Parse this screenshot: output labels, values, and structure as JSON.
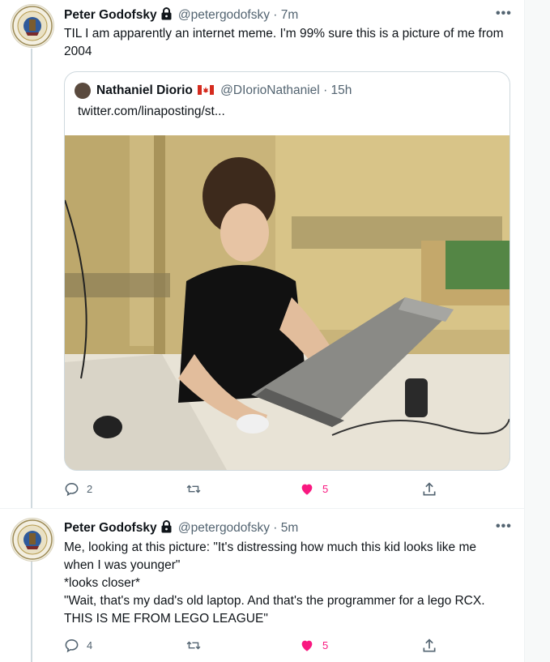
{
  "tweets": [
    {
      "author": "Peter Godofsky",
      "handle": "@petergodofsky",
      "time": "· 7m",
      "more": "•••",
      "text": "TIL I am apparently an internet meme. I'm 99% sure this is a picture of me from 2004",
      "quoted": {
        "author": "Nathaniel Diorio",
        "handle": "@DIorioNathaniel",
        "time": "· 15h",
        "text": "twitter.com/linaposting/st..."
      },
      "replies": "2",
      "likes": "5"
    },
    {
      "author": "Peter Godofsky",
      "handle": "@petergodofsky",
      "time": "· 5m",
      "more": "•••",
      "text": "Me, looking at this picture: \"It's distressing how much this kid looks like me when I was younger\"\n*looks closer*\n\"Wait, that's my dad's old laptop. And that's the programmer for a lego RCX. THIS IS ME FROM LEGO LEAGUE\"",
      "replies": "4",
      "likes": "5"
    }
  ],
  "colors": {
    "like": "#f91880",
    "icon": "#536471",
    "border": "#cfd9de"
  },
  "icons": [
    "lock-icon",
    "canada-flag-icon",
    "reply-icon",
    "retweet-icon",
    "like-icon",
    "share-icon"
  ]
}
